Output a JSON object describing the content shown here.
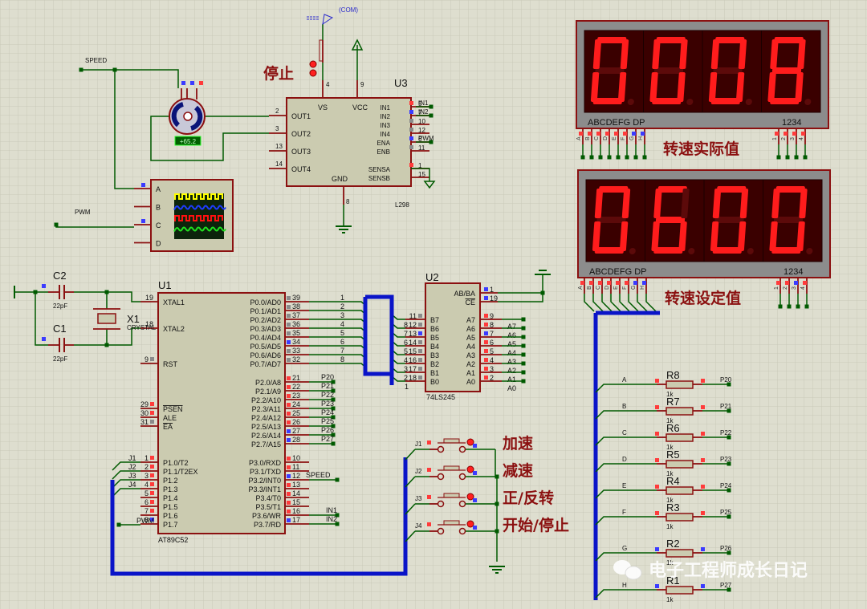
{
  "colors": {
    "background": "#dedecf",
    "grid": "#c9c9b8",
    "wire": "#005a00",
    "pin": "#8b1010",
    "chip_fill": "#cbcbb0",
    "bus": "#0a14c8",
    "seg_on": "#ff1c1c",
    "seg_off": "#5c0a0a",
    "display_bg": "#3a0000",
    "annotation": "#8b1010"
  },
  "displays": [
    {
      "digits": "0008",
      "seg_label": "ABCDEFG  DP",
      "digit_label": "1234",
      "caption": "转速实际值",
      "pins": [
        "A",
        "B",
        "C",
        "D",
        "E",
        "F",
        "G",
        "H"
      ],
      "pin_states": [
        "r",
        "r",
        "r",
        "r",
        "r",
        "r",
        "b",
        "b"
      ],
      "common_pins": [
        "1",
        "2",
        "3",
        "4"
      ],
      "common_states": [
        "r",
        "r",
        "r",
        "r"
      ]
    },
    {
      "digits": "0600",
      "seg_label": "ABCDEFG  DP",
      "digit_label": "1234",
      "caption": "转速设定值",
      "pins": [
        "A",
        "B",
        "C",
        "D",
        "E",
        "F",
        "G",
        "H"
      ],
      "pin_states": [
        "r",
        "r",
        "r",
        "r",
        "r",
        "r",
        "b",
        "b"
      ],
      "common_pins": [
        "1",
        "2",
        "3",
        "4"
      ],
      "common_states": [
        "r",
        "r",
        "b",
        "r"
      ]
    }
  ],
  "u1": {
    "ref": "U1",
    "part": "AT89C52",
    "left_pins": [
      {
        "num": "19",
        "name": "XTAL1",
        "state": ""
      },
      {
        "num": "18",
        "name": "XTAL2",
        "state": ""
      },
      {
        "num": "9",
        "name": "RST",
        "state": "g"
      },
      {
        "num": "29",
        "name": "PSEN",
        "state": "r",
        "overbar": true
      },
      {
        "num": "30",
        "name": "ALE",
        "state": "r"
      },
      {
        "num": "31",
        "name": "EA",
        "state": "g",
        "overbar": true
      },
      {
        "num": "1",
        "name": "P1.0/T2",
        "state": "r"
      },
      {
        "num": "2",
        "name": "P1.1/T2EX",
        "state": "r"
      },
      {
        "num": "3",
        "name": "P1.2",
        "state": "r"
      },
      {
        "num": "4",
        "name": "P1.3",
        "state": "r"
      },
      {
        "num": "5",
        "name": "P1.4",
        "state": "r"
      },
      {
        "num": "6",
        "name": "P1.5",
        "state": "r"
      },
      {
        "num": "7",
        "name": "P1.6",
        "state": "r"
      },
      {
        "num": "8",
        "name": "P1.7",
        "state": "b"
      }
    ],
    "right_pins": [
      {
        "num": "39",
        "name": "P0.0/AD0",
        "state": "g",
        "net": "1"
      },
      {
        "num": "38",
        "name": "P0.1/AD1",
        "state": "g",
        "net": "2"
      },
      {
        "num": "37",
        "name": "P0.2/AD2",
        "state": "g",
        "net": "3"
      },
      {
        "num": "36",
        "name": "P0.3/AD3",
        "state": "g",
        "net": "4"
      },
      {
        "num": "35",
        "name": "P0.4/AD4",
        "state": "g",
        "net": "5"
      },
      {
        "num": "34",
        "name": "P0.5/AD5",
        "state": "b",
        "net": "6"
      },
      {
        "num": "33",
        "name": "P0.6/AD6",
        "state": "g",
        "net": "7"
      },
      {
        "num": "32",
        "name": "P0.7/AD7",
        "state": "g",
        "net": "8"
      },
      {
        "num": "21",
        "name": "P2.0/A8",
        "state": "r",
        "net": "P20"
      },
      {
        "num": "22",
        "name": "P2.1/A9",
        "state": "r",
        "net": "P21"
      },
      {
        "num": "23",
        "name": "P2.2/A10",
        "state": "r",
        "net": "P22"
      },
      {
        "num": "24",
        "name": "P2.3/A11",
        "state": "r",
        "net": "P23"
      },
      {
        "num": "25",
        "name": "P2.4/A12",
        "state": "r",
        "net": "P24"
      },
      {
        "num": "26",
        "name": "P2.5/A13",
        "state": "r",
        "net": "P25"
      },
      {
        "num": "27",
        "name": "P2.6/A14",
        "state": "b",
        "net": "P26"
      },
      {
        "num": "28",
        "name": "P2.7/A15",
        "state": "b",
        "net": "P27"
      },
      {
        "num": "10",
        "name": "P3.0/RXD",
        "state": "r",
        "net": ""
      },
      {
        "num": "11",
        "name": "P3.1/TXD",
        "state": "r",
        "net": ""
      },
      {
        "num": "12",
        "name": "P3.2/INT0",
        "state": "b",
        "net": "SPEED"
      },
      {
        "num": "13",
        "name": "P3.3/INT1",
        "state": "r",
        "net": ""
      },
      {
        "num": "14",
        "name": "P3.4/T0",
        "state": "r",
        "net": ""
      },
      {
        "num": "15",
        "name": "P3.5/T1",
        "state": "r",
        "net": ""
      },
      {
        "num": "16",
        "name": "P3.6/WR",
        "state": "r",
        "net": "IN1"
      },
      {
        "num": "17",
        "name": "P3.7/RD",
        "state": "b",
        "net": "IN2"
      }
    ],
    "p1_nets": [
      "J1",
      "J2",
      "J3",
      "J4",
      "",
      "",
      "",
      "PWM"
    ]
  },
  "u2": {
    "ref": "U2",
    "part": "74LS245",
    "left_pins": [
      {
        "net": "",
        "num": "11",
        "name": "B7",
        "state": "g"
      },
      {
        "net": "8",
        "num": "12",
        "name": "B6",
        "state": "g"
      },
      {
        "net": "7",
        "num": "13",
        "name": "B5",
        "state": "b"
      },
      {
        "net": "6",
        "num": "14",
        "name": "B4",
        "state": "g"
      },
      {
        "net": "5",
        "num": "15",
        "name": "B3",
        "state": "g"
      },
      {
        "net": "4",
        "num": "16",
        "name": "B2",
        "state": "g"
      },
      {
        "net": "3",
        "num": "17",
        "name": "B1",
        "state": "g"
      },
      {
        "net": "2",
        "num": "18",
        "name": "B0",
        "state": "g"
      }
    ],
    "extra_net": "1",
    "ctrl_pins": [
      {
        "num": "1",
        "name": "AB/BA",
        "state": "b"
      },
      {
        "num": "19",
        "name": "CE",
        "state": "b"
      }
    ],
    "right_pins": [
      {
        "num": "9",
        "name": "A7",
        "state": "r",
        "net": "A7"
      },
      {
        "num": "8",
        "name": "A6",
        "state": "r",
        "net": "A6"
      },
      {
        "num": "7",
        "name": "A5",
        "state": "b",
        "net": "A5"
      },
      {
        "num": "6",
        "name": "A4",
        "state": "r",
        "net": "A4"
      },
      {
        "num": "5",
        "name": "A3",
        "state": "r",
        "net": "A3"
      },
      {
        "num": "4",
        "name": "A2",
        "state": "r",
        "net": "A2"
      },
      {
        "num": "3",
        "name": "A1",
        "state": "r",
        "net": "A1"
      },
      {
        "num": "2",
        "name": "A0",
        "state": "r",
        "net": "A0"
      }
    ]
  },
  "u3": {
    "ref": "U3",
    "part": "L298",
    "left_pins": [
      {
        "num": "2",
        "name": "OUT1"
      },
      {
        "num": "3",
        "name": "OUT2"
      },
      {
        "num": "13",
        "name": "OUT3"
      },
      {
        "num": "14",
        "name": "OUT4"
      }
    ],
    "top_pins": [
      {
        "num": "4",
        "name": "VS"
      },
      {
        "num": "9",
        "name": "VCC"
      }
    ],
    "bottom_pin": {
      "num": "8",
      "name": "GND"
    },
    "right_pins": [
      {
        "num": "5",
        "name": "IN1",
        "state": "r",
        "net": "IN1"
      },
      {
        "num": "7",
        "name": "IN2",
        "state": "b",
        "net": "IN2"
      },
      {
        "num": "10",
        "name": "IN3",
        "state": "g",
        "net": ""
      },
      {
        "num": "12",
        "name": "IN4",
        "state": "g",
        "net": ""
      },
      {
        "num": "6",
        "name": "ENA",
        "state": "b",
        "net": "PWM"
      },
      {
        "num": "11",
        "name": "ENB",
        "state": "g",
        "net": ""
      },
      {
        "num": "1",
        "name": "SENSA",
        "state": "r",
        "net": ""
      },
      {
        "num": "15",
        "name": "SENSB",
        "state": "",
        "net": ""
      }
    ]
  },
  "motor": {
    "readout": "+65.2"
  },
  "scope": {
    "channels": [
      "A",
      "B",
      "C",
      "D"
    ],
    "trace_colors": [
      "#ffff00",
      "#1e3cff",
      "#ff1010",
      "#20e020"
    ]
  },
  "nets": {
    "speed": "SPEED",
    "pwm": "PWM",
    "com": "(COM)"
  },
  "stop_switch": {
    "caption": "停止"
  },
  "crystal": {
    "c2": "C2",
    "c1": "C1",
    "cap_value": "22pF",
    "x1": "X1",
    "x1_part": "CRYSTAL"
  },
  "switches": [
    {
      "ref": "J1",
      "caption": "加速"
    },
    {
      "ref": "J2",
      "caption": "减速"
    },
    {
      "ref": "J3",
      "caption": "正/反转"
    },
    {
      "ref": "J4",
      "caption": "开始/停止"
    }
  ],
  "resistors": [
    {
      "ref": "R8",
      "value": "1k",
      "left": "A",
      "right": "P20",
      "state": "r"
    },
    {
      "ref": "R7",
      "value": "1k",
      "left": "B",
      "right": "P21",
      "state": "r"
    },
    {
      "ref": "R6",
      "value": "1k",
      "left": "C",
      "right": "P22",
      "state": "r"
    },
    {
      "ref": "R5",
      "value": "1k",
      "left": "D",
      "right": "P23",
      "state": "r"
    },
    {
      "ref": "R4",
      "value": "1k",
      "left": "E",
      "right": "P24",
      "state": "r"
    },
    {
      "ref": "R3",
      "value": "1k",
      "left": "F",
      "right": "P25",
      "state": "r"
    },
    {
      "ref": "R2",
      "value": "1k",
      "left": "G",
      "right": "P26",
      "state": "b"
    },
    {
      "ref": "R1",
      "value": "1k",
      "left": "H",
      "right": "P27",
      "state": "b"
    }
  ],
  "watermark": {
    "text": "电子工程师成长日记",
    "icon": "wechat-icon"
  }
}
